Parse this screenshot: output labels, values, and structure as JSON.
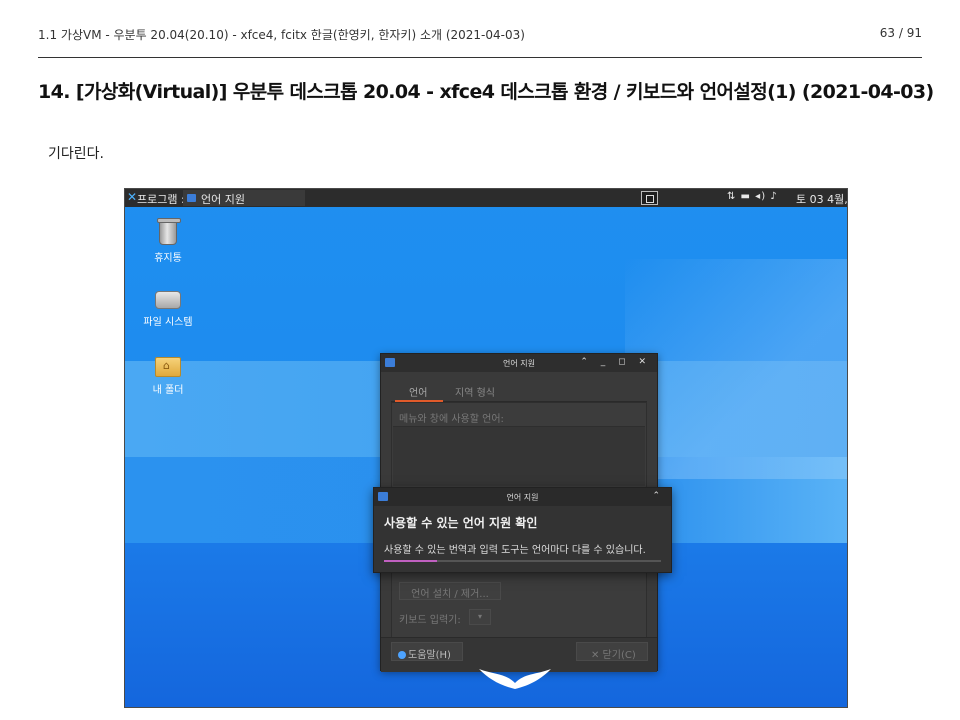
{
  "header": {
    "left": "1.1 가상VM - 우분투 20.04(20.10) - xfce4, fcitx 한글(한영키, 한자키) 소개 (2021-04-03)",
    "right": "63 / 91"
  },
  "heading": "14. [가상화(Virtual)] 우분투 데스크톱 20.04 - xfce4 데스크톱 환경 / 키보드와 언어설정(1) (2021-04-03)",
  "body_text": "기다린다.",
  "screenshot": {
    "panel": {
      "menu_label": "프로그램 :",
      "task_label": "언어 지원",
      "tray_icons": "⇅ ▬ ◂) ♪",
      "clock": "토 03  4월,"
    },
    "desktop_icons": [
      {
        "label": "휴지통",
        "icon": "trash-icon"
      },
      {
        "label": "파일 시스템",
        "icon": "drive-icon"
      },
      {
        "label": "내 폴더",
        "icon": "home-folder-icon"
      }
    ],
    "main_window": {
      "title": "언어 지원",
      "title_buttons": "⌃ _ ◻ ✕",
      "tabs": [
        "언어",
        "지역 형식"
      ],
      "language_label": "메뉴와 창에 사용할 언어:",
      "install_button": "언어 설치 / 제거...",
      "keyboard_label": "키보드 입력기:",
      "keyboard_select": "▾",
      "help_button": "도움말(H)",
      "close_button": "✕ 닫기(C)"
    },
    "progress_dialog": {
      "title": "언어 지원",
      "collapse": "⌃",
      "heading": "사용할 수 있는 언어 지원 확인",
      "text": "사용할 수 있는 번역과 입력 도구는 언어마다 다를 수 있습니다.",
      "progress": 0.19,
      "progress_color": "#c060c0"
    }
  }
}
